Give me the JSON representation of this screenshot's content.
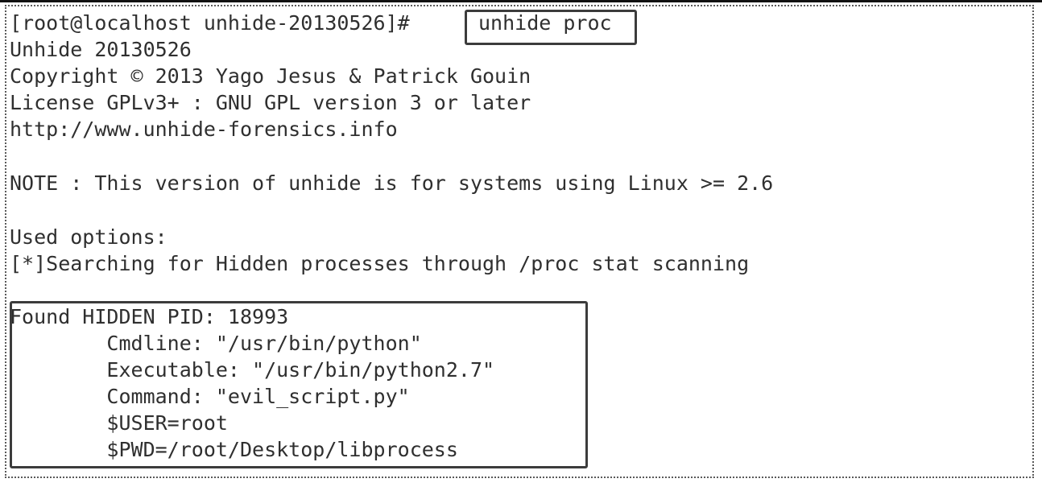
{
  "terminal": {
    "prompt": "[root@localhost unhide-20130526]#",
    "command": "unhide proc",
    "banner": [
      "Unhide 20130526",
      "Copyright © 2013 Yago Jesus & Patrick Gouin",
      "License GPLv3+ : GNU GPL version 3 or later",
      "http://www.unhide-forensics.info"
    ],
    "note": "NOTE : This version of unhide is for systems using Linux >= 2.6",
    "options_header": "Used options:",
    "scan_line": "[*]Searching for Hidden processes through /proc stat scanning",
    "found": {
      "header": "Found HIDDEN PID: 18993",
      "cmdline": "        Cmdline: \"/usr/bin/python\"",
      "executable": "        Executable: \"/usr/bin/python2.7\"",
      "command": "        Command: \"evil_script.py\"",
      "user": "        $USER=root",
      "pwd": "        $PWD=/root/Desktop/libprocess"
    }
  }
}
